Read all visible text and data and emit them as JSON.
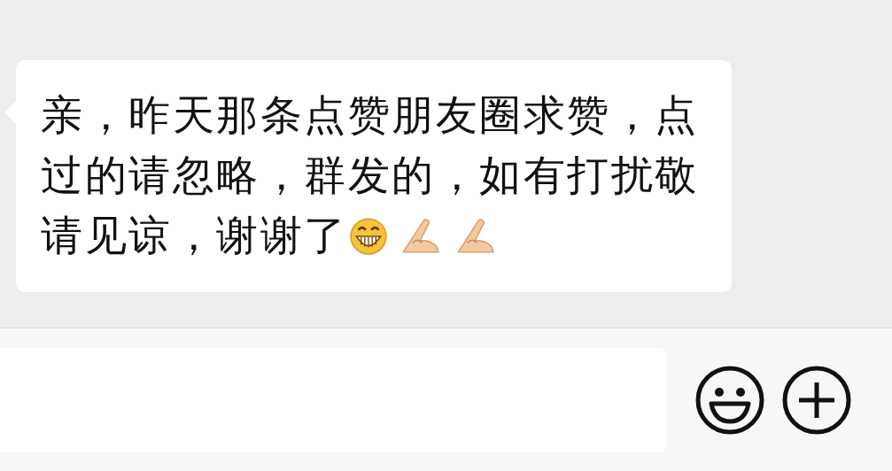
{
  "message": {
    "lines": [
      "亲，昨天那条点赞朋友圈求赞，点",
      "过的请忽略，群发的，如有打扰敬",
      "请见谅，谢谢了"
    ]
  }
}
